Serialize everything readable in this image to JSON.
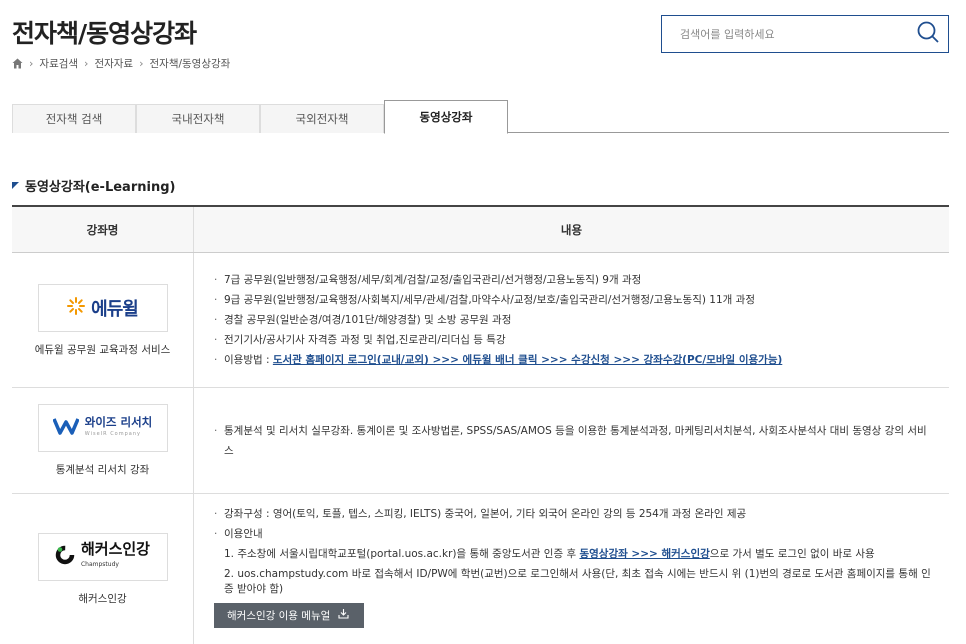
{
  "page": {
    "title": "전자책/동영상강좌"
  },
  "breadcrumb": {
    "items": [
      "자료검색",
      "전자자료",
      "전자책/동영상강좌"
    ]
  },
  "search": {
    "placeholder": "검색어를 입력하세요"
  },
  "tabs": [
    {
      "label": "전자책 검색",
      "active": false
    },
    {
      "label": "국내전자책",
      "active": false
    },
    {
      "label": "국외전자책",
      "active": false
    },
    {
      "label": "동영상강좌",
      "active": true
    }
  ],
  "section": {
    "title": "동영상강좌(e-Learning)"
  },
  "table": {
    "headers": [
      "강좌명",
      "내용"
    ],
    "rows": [
      {
        "logo_text": "에듀윌",
        "name": "에듀윌 공무원 교육과정 서비스",
        "lines": [
          "7급 공무원(일반행정/교육행정/세무/회계/검찰/교정/출입국관리/선거행정/고용노동직) 9개 과정",
          "9급 공무원(일반행정/교육행정/사회복지/세무/관세/검찰,마약수사/교정/보호/출입국관리/선거행정/고용노동직) 11개 과정",
          "경찰 공무원(일반순경/여경/101단/해양경찰) 및 소방 공무원 과정",
          "전기기사/공사기사 자격증 과정 및 취업,진로관리/리더십 등 특강"
        ],
        "usage_label": "이용방법 : ",
        "usage_link": "도서관 홈페이지 로그인(교내/교외) >>> 에듀윌 배너 클릭 >>> 수강신청 >>> 강좌수강(PC/모바일 이용가능)"
      },
      {
        "logo_text": "와이즈 리서치",
        "logo_sub": "WiseIR Company",
        "name": "통계분석 리서치 강좌",
        "lines": [
          "통계분석 및 리서치 실무강좌. 통계이론 및 조사방법론, SPSS/SAS/AMOS 등을 이용한 통계분석과정, 마케팅리서치분석, 사회조사분석사 대비 동영상 강의 서비스"
        ]
      },
      {
        "logo_text": "해커스인강",
        "logo_sub": "Champstudy",
        "name": "해커스인강",
        "line1": "강좌구성 : 영어(토익, 토플, 텝스, 스피킹, IELTS) 중국어, 일본어, 기타 외국어 온라인 강의 등 254개 과정 온라인 제공",
        "line2": "이용안내",
        "step1_pre": "1. 주소창에 서울시립대학교포털(portal.uos.ac.kr)을 통해 중앙도서관 인증 후 ",
        "step1_link": "동영상강좌 >>> 해커스인강",
        "step1_post": "으로 가서 별도 로그인 없이 바로 사용",
        "step2": "2. uos.champstudy.com 바로 접속해서 ID/PW에 학번(교번)으로 로그인해서 사용(단, 최초 접속 시에는 반드시 위 (1)번의 경로로 도서관 홈페이지를 통해 인증 받아야 함)",
        "button_label": "해커스인강 이용 메뉴얼"
      }
    ]
  },
  "colors": {
    "accent": "#1f4e8f",
    "edu_orange": "#f39800",
    "wise_blue": "#1b5fb8",
    "button_bg": "#5a6169"
  }
}
